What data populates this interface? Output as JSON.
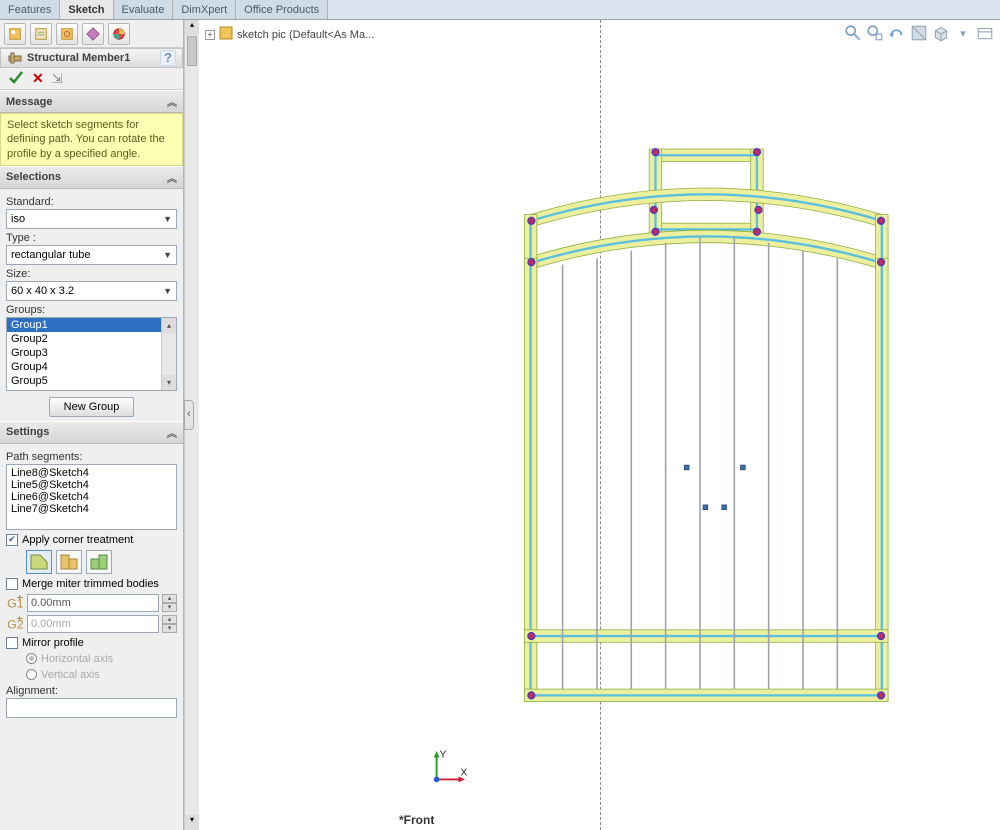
{
  "tabs": {
    "features": "Features",
    "sketch": "Sketch",
    "evaluate": "Evaluate",
    "dimxpert": "DimXpert",
    "office": "Office Products"
  },
  "breadcrumb": "sketch pic  (Default<As Ma...",
  "feature": {
    "title": "Structural Member1"
  },
  "message": {
    "head": "Message",
    "body": "Select sketch segments for defining path. You can rotate the profile by a specified angle."
  },
  "selections": {
    "head": "Selections",
    "standard_label": "Standard:",
    "standard_value": "iso",
    "type_label": "Type :",
    "type_value": "rectangular tube",
    "size_label": "Size:",
    "size_value": "60 x 40 x 3.2",
    "groups_label": "Groups:",
    "groups": [
      "Group1",
      "Group2",
      "Group3",
      "Group4",
      "Group5"
    ],
    "new_group": "New Group"
  },
  "settings": {
    "head": "Settings",
    "pathseg_label": "Path segments:",
    "pathsegs": [
      "Line8@Sketch4",
      "Line5@Sketch4",
      "Line6@Sketch4",
      "Line7@Sketch4"
    ],
    "apply_corner": "Apply corner treatment",
    "merge_miter": "Merge miter trimmed bodies",
    "g1": "0.00mm",
    "g2": "0.00mm",
    "mirror": "Mirror profile",
    "horiz": "Horizontal axis",
    "vert": "Vertical axis",
    "alignment": "Alignment:"
  },
  "axes": {
    "x": "X",
    "y": "Y"
  },
  "footer": "*Front"
}
